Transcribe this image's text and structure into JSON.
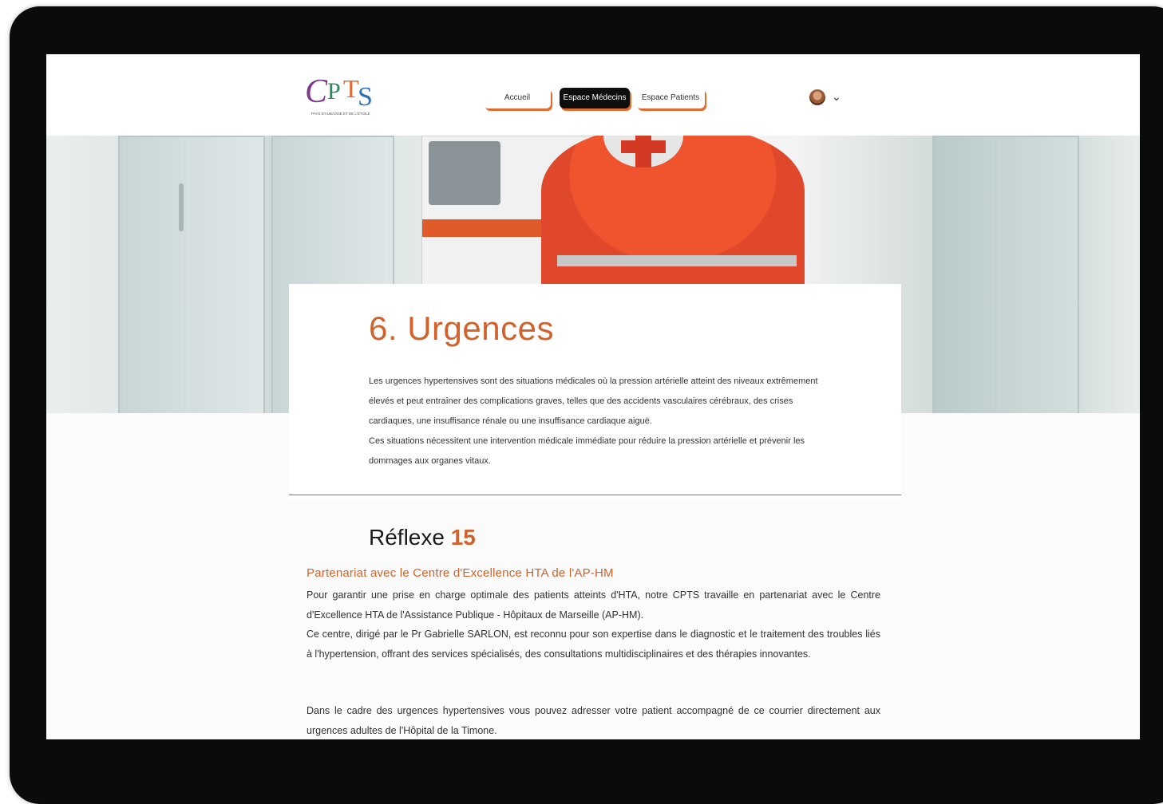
{
  "header": {
    "logo_text": "CPTS",
    "logo_subtitle": "PAYS D'AUBAGNE ET DE L'ÉTOILE",
    "nav": [
      {
        "label": "Accueil"
      },
      {
        "label": "Espace Médecins"
      },
      {
        "label": "Espace Patients"
      }
    ]
  },
  "main": {
    "title": "6. Urgences",
    "intro": "Les urgences hypertensives sont des situations médicales où la pression artérielle atteint des niveaux extrêmement élevés et peut entraîner des complications graves, telles que des accidents vasculaires cérébraux, des crises cardiaques, une insuffisance rénale ou une insuffisance cardiaque aiguë.",
    "intro2": "Ces situations nécessitent une intervention médicale immédiate pour réduire la pression artérielle et prévenir les dommages aux organes vitaux.",
    "reflexe_label": "Réflexe",
    "reflexe_number": "15",
    "partner_title": "Partenariat avec le Centre d'Excellence HTA de l'AP-HM",
    "p1": "Pour garantir une prise en charge optimale des patients atteints d'HTA, notre CPTS travaille en partenariat avec le Centre d'Excellence HTA de l'Assistance Publique - Hôpitaux de Marseille (AP-HM).",
    "p2": "Ce centre, dirigé par le Pr Gabrielle SARLON, est reconnu pour son expertise dans le diagnostic et le traitement des troubles liés à l'hypertension, offrant des services spécialisés, des consultations multidisciplinaires et des thérapies innovantes.",
    "p3": "Dans le cadre des urgences hypertensives vous pouvez adresser votre patient accompagné de ce courrier directement aux urgences adultes de l'Hôpital de la Timone."
  },
  "colors": {
    "accent": "#d2622b",
    "nav_active_bg": "#0d0d0d",
    "bezel": "#0b0b0b"
  },
  "icons": {
    "account": "avatar",
    "dropdown": "chevron-down-icon"
  }
}
